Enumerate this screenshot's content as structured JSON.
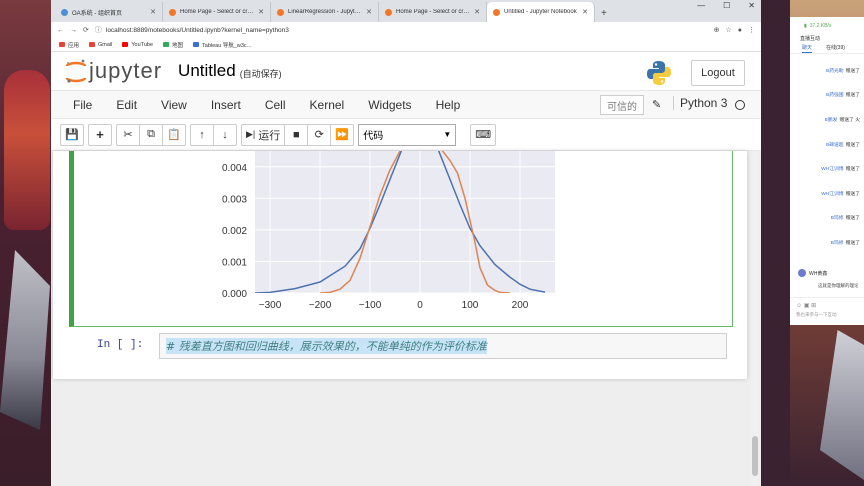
{
  "browser": {
    "tabs": [
      {
        "label": "OA系统 - 组织首页",
        "color": "#4a90d9",
        "active": false
      },
      {
        "label": "Home Page - Select or create",
        "color": "#f37726",
        "active": false
      },
      {
        "label": "LinearRegression - Jupyter No",
        "color": "#f37726",
        "active": false
      },
      {
        "label": "Home Page - Select or create",
        "color": "#f37726",
        "active": false
      },
      {
        "label": "Untitled - Jupyter Notebook",
        "color": "#f37726",
        "active": true
      }
    ],
    "new_tab": "+",
    "url": "localhost:8889/notebooks/Untitled.ipynb?kernel_name=python3",
    "bookmarks": [
      {
        "label": "应用",
        "color": "#e94235"
      },
      {
        "label": "Gmail",
        "color": "#ea4335"
      },
      {
        "label": "YouTube",
        "color": "#ff0000"
      },
      {
        "label": "地图",
        "color": "#34a853"
      },
      {
        "label": "Tableau 导航_w3c...",
        "color": "#3b6fd8"
      }
    ]
  },
  "jupyter": {
    "logo_text": "jupyter",
    "notebook_title": "Untitled",
    "autosave": "(自动保存)",
    "logout": "Logout",
    "menu": [
      "File",
      "Edit",
      "View",
      "Insert",
      "Cell",
      "Kernel",
      "Widgets",
      "Help"
    ],
    "trusted": "可信的",
    "kernel": "Python 3",
    "toolbar": {
      "run_label": "运行",
      "cell_type": "代码"
    }
  },
  "chart_data": {
    "type": "line",
    "x_ticks": [
      "−300",
      "−200",
      "−100",
      "0",
      "100",
      "200"
    ],
    "y_ticks": [
      "0.000",
      "0.001",
      "0.002",
      "0.003",
      "0.004"
    ],
    "xlim": [
      -330,
      270
    ],
    "ylim": [
      0,
      0.0045
    ],
    "grid": true,
    "series": [
      {
        "color": "#4c72b0",
        "x": [
          -330,
          -300,
          -250,
          -200,
          -150,
          -120,
          -100,
          -80,
          -60,
          -40,
          -20
        ],
        "y": [
          0.0,
          2e-05,
          0.00014,
          0.00035,
          0.00085,
          0.0014,
          0.00205,
          0.0028,
          0.0036,
          0.0044,
          0.0052
        ],
        "x2": [
          20,
          40,
          60,
          80,
          100,
          120,
          150,
          180,
          200,
          220,
          250
        ],
        "y2": [
          0.0052,
          0.0044,
          0.0036,
          0.0028,
          0.00205,
          0.0015,
          0.0009,
          0.0005,
          0.00028,
          0.00012,
          3e-05
        ]
      },
      {
        "color": "#dd8452",
        "x": [
          -200,
          -180,
          -160,
          -140,
          -120,
          -100,
          -80,
          -60,
          -40,
          -25
        ],
        "y": [
          0.0,
          2e-05,
          0.00012,
          0.0004,
          0.0011,
          0.0021,
          0.0031,
          0.0039,
          0.0045,
          0.0052
        ],
        "x2": [
          25,
          40,
          60,
          75,
          90,
          100,
          110,
          120,
          135,
          150,
          160,
          180
        ],
        "y2": [
          0.0052,
          0.0046,
          0.0042,
          0.0038,
          0.003,
          0.0023,
          0.0016,
          0.0008,
          0.00025,
          8e-05,
          2e-05,
          0.0
        ]
      }
    ]
  },
  "cells": {
    "next_prompt": "In  [  ]:",
    "next_code": "# 残差直方图和回归曲线，展示效果的，不能单纯的作为评价标准"
  },
  "chat": {
    "speed": "37.2 KB/s",
    "title": "直播互动",
    "tabs": [
      "聊天",
      "在线(39)"
    ],
    "messages": [
      {
        "user": "B药光助",
        "text": "赠送了"
      },
      {
        "user": "B药强国",
        "text": "赠送了"
      },
      {
        "user": "B鹏发",
        "text": "赠送了 火"
      },
      {
        "user": "B碑道超",
        "text": "赠送了"
      },
      {
        "user": "WH江训博",
        "text": "赠送了"
      },
      {
        "user": "WH江训博",
        "text": "赠送了"
      },
      {
        "user": "B玛修",
        "text": "赠送了"
      },
      {
        "user": "B玛修",
        "text": "赠送了"
      }
    ],
    "last_user": "WH黄鑫",
    "last_text": "这就是你理解的理论",
    "input_placeholder": "我也来参与一下互动"
  }
}
